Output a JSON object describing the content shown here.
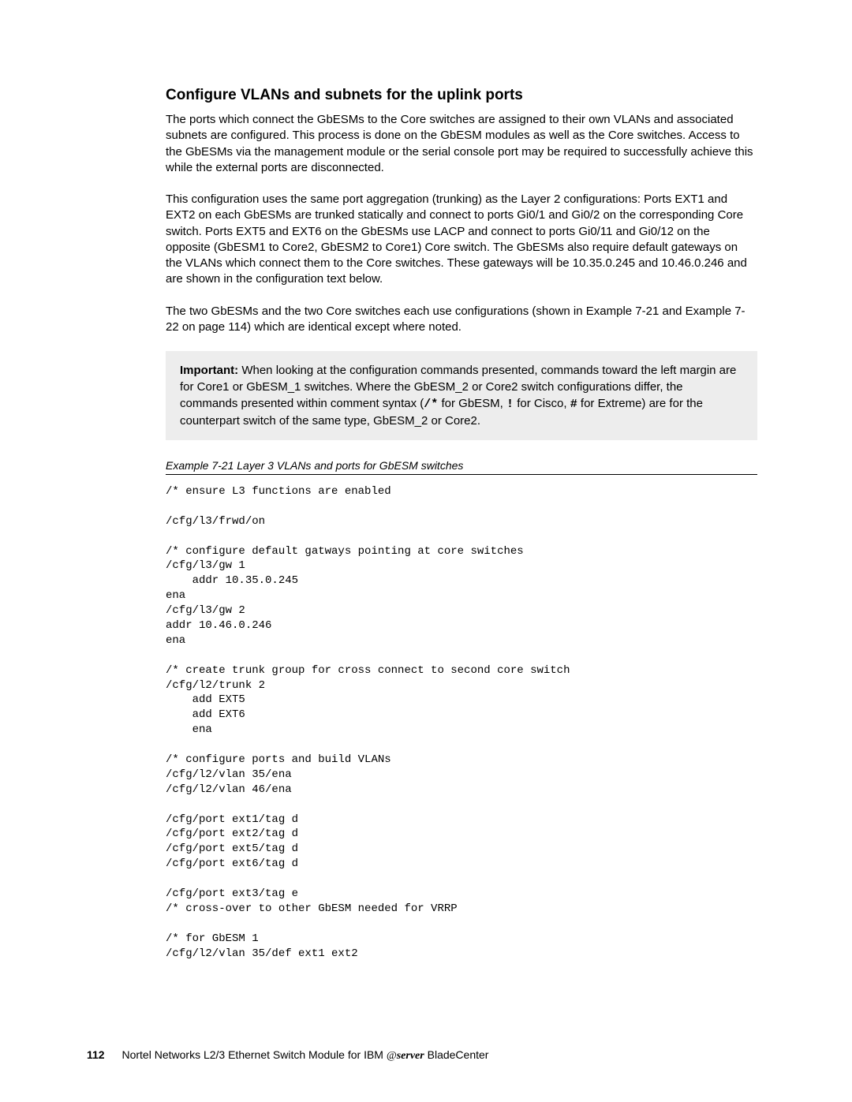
{
  "heading": "Configure VLANs and subnets for the uplink ports",
  "p1": "The ports which connect the GbESMs to the Core switches are assigned to their own VLANs and associated subnets are configured. This process is done on the GbESM modules as well as the Core switches. Access to the GbESMs via the management module or the serial console port may be required to successfully achieve this while the external ports are disconnected.",
  "p2": "This configuration uses the same port aggregation (trunking) as the Layer 2 configurations: Ports EXT1 and EXT2 on each GbESMs are trunked statically and connect to ports Gi0/1 and Gi0/2 on the corresponding Core switch. Ports EXT5 and EXT6 on the GbESMs use LACP and connect to ports Gi0/11 and Gi0/12 on the opposite (GbESM1 to Core2, GbESM2 to Core1) Core switch. The GbESMs also require default gateways on the VLANs which connect them to the Core switches. These gateways will be 10.35.0.245 and 10.46.0.246 and are shown in the configuration text below.",
  "p3": "The two GbESMs and the two Core switches each use configurations (shown in Example 7-21 and Example 7-22 on page 114) which are identical except where noted.",
  "note": {
    "label": "Important:",
    "text_a": " When looking at the configuration commands presented, commands toward the left margin are for Core1 or GbESM_1 switches. Where the GbESM_2 or Core2 switch configurations differ, the commands presented within comment syntax (",
    "sy1": "/*",
    "text_b": " for GbESM, ",
    "sy2": "!",
    "text_c": " for Cisco, ",
    "sy3": "#",
    "text_d": " for Extreme) are for the counterpart switch of the same type, GbESM_2 or Core2."
  },
  "example_caption": "Example 7-21   Layer 3 VLANs and ports for GbESM switches",
  "code": "/* ensure L3 functions are enabled\n\n/cfg/l3/frwd/on\n\n/* configure default gatways pointing at core switches\n/cfg/l3/gw 1\n    addr 10.35.0.245\nena\n/cfg/l3/gw 2\naddr 10.46.0.246\nena\n\n/* create trunk group for cross connect to second core switch\n/cfg/l2/trunk 2\n    add EXT5\n    add EXT6\n    ena\n\n/* configure ports and build VLANs\n/cfg/l2/vlan 35/ena\n/cfg/l2/vlan 46/ena\n\n/cfg/port ext1/tag d\n/cfg/port ext2/tag d\n/cfg/port ext5/tag d\n/cfg/port ext6/tag d\n\n/cfg/port ext3/tag e\n/* cross-over to other GbESM needed for VRRP\n\n/* for GbESM 1\n/cfg/l2/vlan 35/def ext1 ext2",
  "footer": {
    "page": "112",
    "text_a": "Nortel Networks L2/3 Ethernet Switch Module for IBM ",
    "at": "@",
    "brand": "server",
    "text_b": " BladeCenter"
  }
}
